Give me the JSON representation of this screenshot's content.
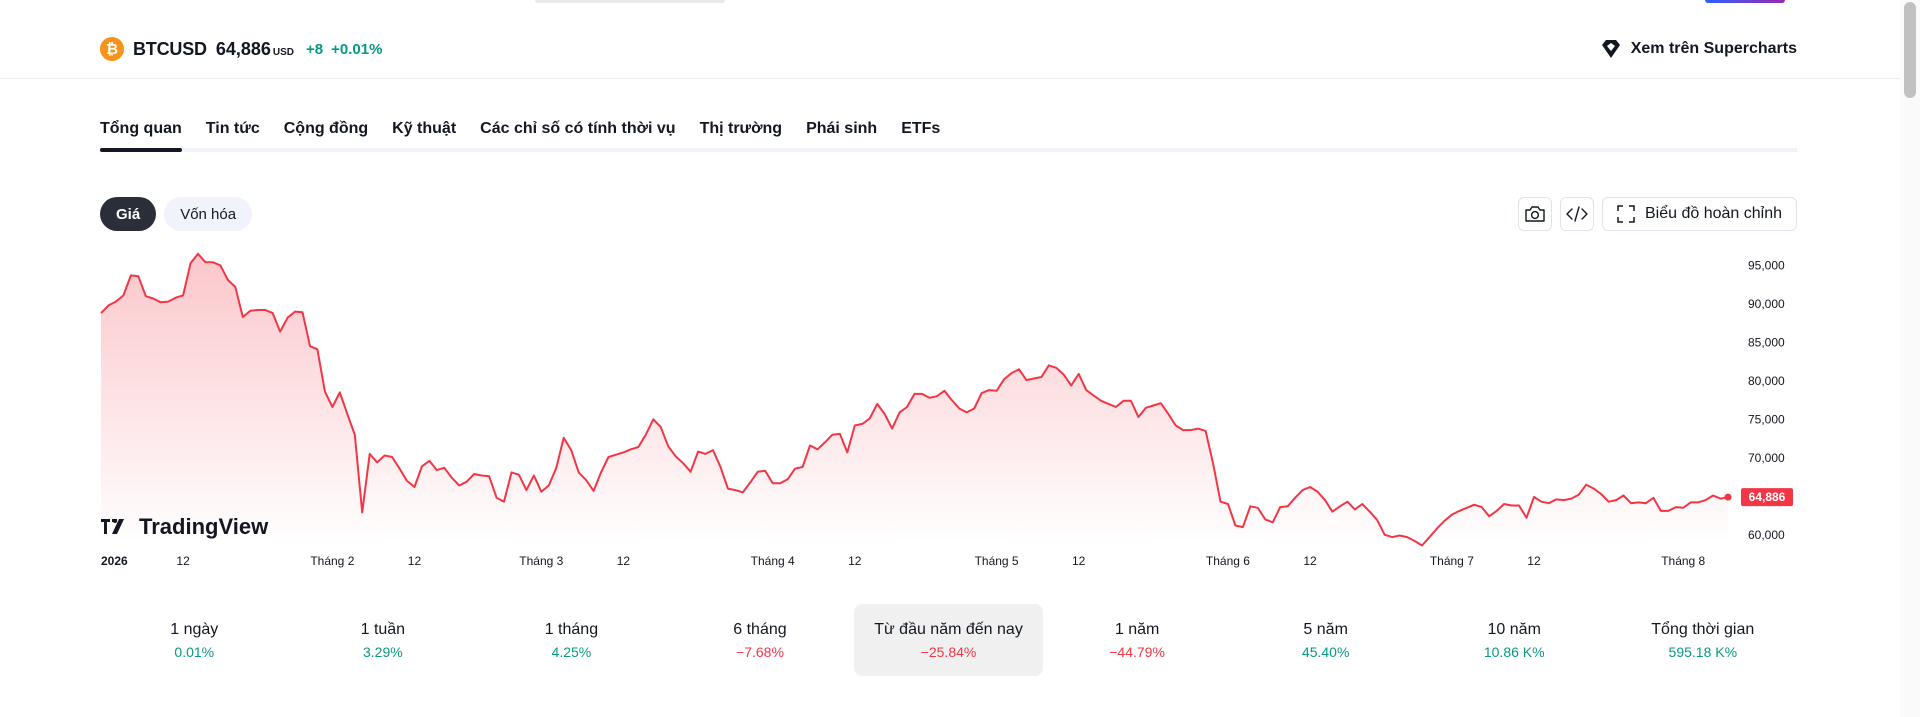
{
  "header": {
    "logo_letter": "₿",
    "symbol": "BTCUSD",
    "price": "64,886",
    "currency": "USD",
    "change_abs": "+8",
    "change_pct": "+0.01%",
    "supercharts_label": "Xem trên Supercharts"
  },
  "tabs": [
    {
      "label": "Tổng quan",
      "active": true
    },
    {
      "label": "Tin tức"
    },
    {
      "label": "Cộng đồng"
    },
    {
      "label": "Kỹ thuật"
    },
    {
      "label": "Các chỉ số có tính thời vụ"
    },
    {
      "label": "Thị trường"
    },
    {
      "label": "Phái sinh"
    },
    {
      "label": "ETFs"
    }
  ],
  "segment": {
    "price_label": "Giá",
    "marketcap_label": "Vốn hóa"
  },
  "toolbar": {
    "full_chart_label": "Biểu đồ hoàn chỉnh"
  },
  "colors": {
    "line": "#f23645",
    "positive": "#089981",
    "negative": "#f23645"
  },
  "chart_data": {
    "type": "area",
    "watermark": "TradingView",
    "y_ticks": [
      95000,
      90000,
      85000,
      80000,
      75000,
      70000,
      65000,
      60000
    ],
    "y_tick_labels": [
      "95,000",
      "90,000",
      "85,000",
      "80,000",
      "75,000",
      "70,000",
      "",
      "60,000"
    ],
    "ylim": [
      57500,
      97000
    ],
    "xlim": [
      0,
      218
    ],
    "x_ticks": [
      {
        "x": 0,
        "label": "2026"
      },
      {
        "x": 11,
        "label": "12"
      },
      {
        "x": 31,
        "label": "Tháng 2"
      },
      {
        "x": 42,
        "label": "12"
      },
      {
        "x": 59,
        "label": "Tháng 3"
      },
      {
        "x": 70,
        "label": "12"
      },
      {
        "x": 90,
        "label": "Tháng 4"
      },
      {
        "x": 101,
        "label": "12"
      },
      {
        "x": 120,
        "label": "Tháng 5"
      },
      {
        "x": 131,
        "label": "12"
      },
      {
        "x": 151,
        "label": "Tháng 6"
      },
      {
        "x": 162,
        "label": "12"
      },
      {
        "x": 181,
        "label": "Tháng 7"
      },
      {
        "x": 192,
        "label": "12"
      },
      {
        "x": 212,
        "label": "Tháng 8"
      }
    ],
    "last_value": 64886,
    "last_label": "64,886",
    "values": [
      88800,
      89800,
      90300,
      91100,
      93700,
      93600,
      91000,
      90700,
      90200,
      90300,
      90800,
      91100,
      95300,
      96500,
      95400,
      95400,
      95000,
      93100,
      92200,
      88300,
      89100,
      89200,
      89200,
      88800,
      86400,
      88200,
      89000,
      88900,
      84500,
      84100,
      78600,
      76600,
      78500,
      75700,
      73000,
      62900,
      70500,
      69400,
      70300,
      70100,
      68600,
      67000,
      66200,
      68900,
      69600,
      68400,
      68700,
      67400,
      66400,
      66900,
      67900,
      67700,
      67600,
      64800,
      64300,
      68100,
      67800,
      65800,
      67700,
      65600,
      66400,
      68700,
      72600,
      71000,
      68100,
      67100,
      65700,
      68100,
      70100,
      70400,
      70700,
      71100,
      71400,
      73000,
      75000,
      74000,
      71500,
      70200,
      69300,
      68200,
      70800,
      70500,
      71000,
      68800,
      66000,
      65800,
      65500,
      66800,
      68200,
      68300,
      66700,
      66700,
      67200,
      68600,
      68800,
      71600,
      71100,
      72000,
      73000,
      73100,
      70700,
      74200,
      74400,
      75100,
      77000,
      75700,
      73800,
      75900,
      76600,
      78300,
      78300,
      77800,
      78000,
      78700,
      77500,
      76400,
      75900,
      76400,
      78400,
      78800,
      78700,
      80200,
      81000,
      81500,
      80100,
      80300,
      80500,
      82000,
      81700,
      80800,
      79400,
      80900,
      78800,
      78100,
      77400,
      77000,
      76600,
      77400,
      77400,
      75300,
      76500,
      76800,
      77100,
      75700,
      74200,
      73600,
      73600,
      73800,
      73500,
      69300,
      64300,
      64000,
      61200,
      61000,
      63700,
      63500,
      62000,
      61600,
      63600,
      63700,
      64800,
      65800,
      66200,
      65600,
      64500,
      63000,
      63700,
      64300,
      63300,
      64000,
      63000,
      61900,
      60000,
      59700,
      59900,
      59700,
      59200,
      58600,
      59700,
      60800,
      61800,
      62600,
      63100,
      63500,
      63900,
      63600,
      62400,
      63100,
      64000,
      63800,
      63800,
      62200,
      64900,
      64300,
      64100,
      64600,
      64500,
      64700,
      65200,
      66500,
      66000,
      65300,
      64300,
      64500,
      65100,
      64100,
      64200,
      64100,
      64800,
      63100,
      63100,
      63600,
      63500,
      64200,
      64200,
      64500,
      65100,
      64700,
      64886
    ]
  },
  "performance": [
    {
      "label": "1 ngày",
      "value": "0.01%",
      "dir": "pos"
    },
    {
      "label": "1 tuần",
      "value": "3.29%",
      "dir": "pos"
    },
    {
      "label": "1 tháng",
      "value": "4.25%",
      "dir": "pos"
    },
    {
      "label": "6 tháng",
      "value": "−7.68%",
      "dir": "neg"
    },
    {
      "label": "Từ đầu năm đến nay",
      "value": "−25.84%",
      "dir": "neg",
      "active": true
    },
    {
      "label": "1 năm",
      "value": "−44.79%",
      "dir": "neg"
    },
    {
      "label": "5 năm",
      "value": "45.40%",
      "dir": "pos"
    },
    {
      "label": "10 năm",
      "value": "10.86 K%",
      "dir": "pos"
    },
    {
      "label": "Tổng thời gian",
      "value": "595.18 K%",
      "dir": "pos"
    }
  ]
}
